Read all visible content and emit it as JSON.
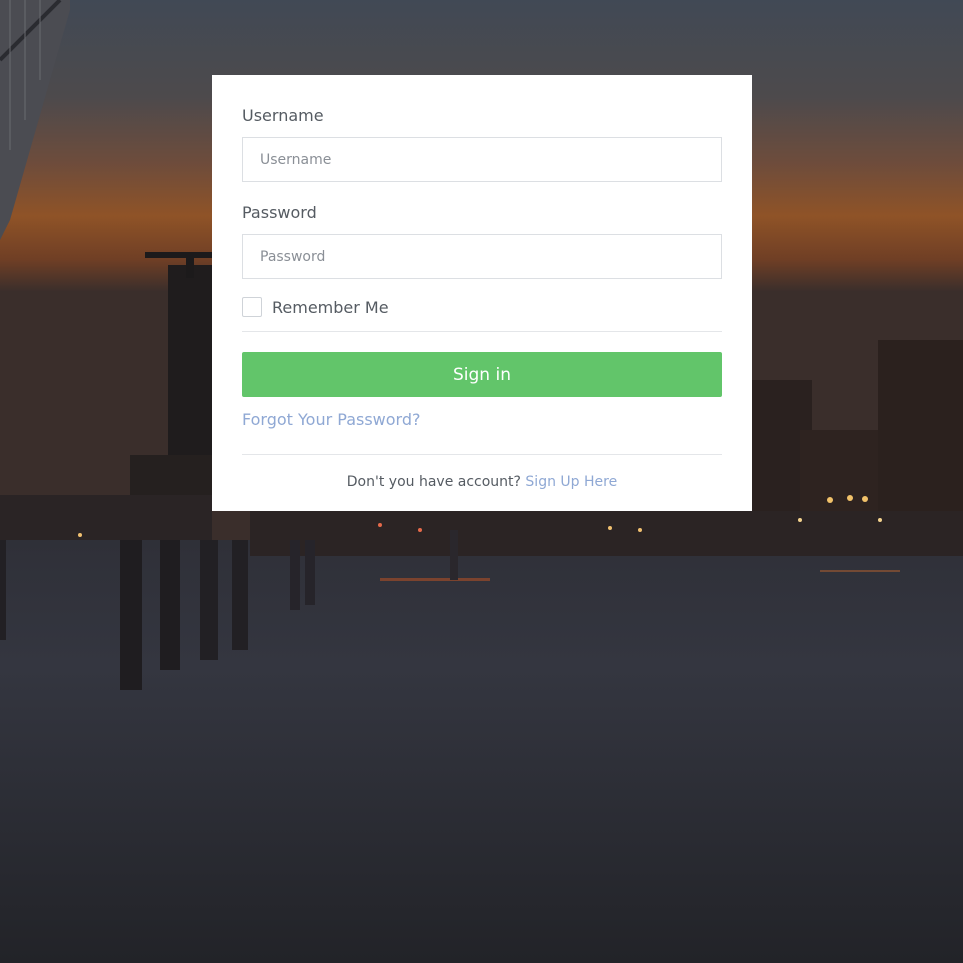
{
  "login_form": {
    "username_label": "Username",
    "username_placeholder": "Username",
    "username_value": "",
    "password_label": "Password",
    "password_placeholder": "Password",
    "password_value": "",
    "remember_label": "Remember Me",
    "remember_checked": false,
    "signin_label": "Sign in",
    "forgot_label": "Forgot Your Password?",
    "signup_prompt": "Don't you have account?",
    "signup_link": "Sign Up Here"
  },
  "colors": {
    "primary_button": "#62c56a",
    "link": "#8fa8d4",
    "card_background": "#ffffff"
  },
  "background": {
    "subject": "harbor at dusk with lit waterfront buildings and pier"
  }
}
